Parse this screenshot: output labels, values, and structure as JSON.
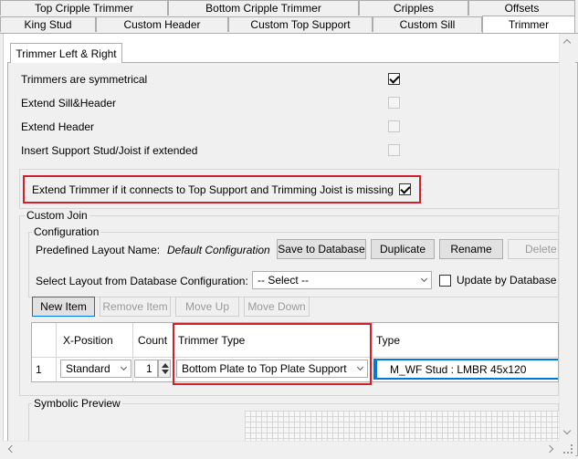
{
  "tabs_row1": [
    "Top Cripple Trimmer",
    "Bottom Cripple Trimmer",
    "Cripples",
    "Offsets"
  ],
  "tabs_row2": [
    "King Stud",
    "Custom Header",
    "Custom Top Support",
    "Custom Sill",
    "Trimmer"
  ],
  "inner_tab": "Trimmer Left & Right",
  "options": {
    "symmetrical": "Trimmers are symmetrical",
    "extend_sill_header": "Extend Sill&Header",
    "extend_header": "Extend Header",
    "insert_support": "Insert Support Stud/Joist if extended",
    "extend_trimmer": "Extend Trimmer if it connects to Top Support and Trimming Joist is missing"
  },
  "custom_join": {
    "title": "Custom Join",
    "configuration_title": "Configuration",
    "predefined_label": "Predefined Layout Name:",
    "predefined_value": "Default Configuration",
    "save_button": "Save to Database",
    "duplicate_button": "Duplicate",
    "rename_button": "Rename",
    "delete_button": "Delete",
    "select_layout_label": "Select Layout from Database Configuration:",
    "select_layout_value": "-- Select --",
    "update_by_db": "Update by Database"
  },
  "toolbar": {
    "new_item": "New Item",
    "remove_item": "Remove Item",
    "move_up": "Move Up",
    "move_down": "Move Down"
  },
  "grid": {
    "headers": [
      "X-Position",
      "Count",
      "Trimmer Type",
      "Type"
    ],
    "row": {
      "index": "1",
      "x_position": "Standard",
      "count": "1",
      "trimmer_type": "Bottom Plate to Top Plate Support",
      "type": "M_WF Stud : LMBR 45x120"
    }
  },
  "symbolic_preview": "Symbolic Preview",
  "colors": {
    "highlight": "#d0202a",
    "selection": "#0078d7"
  }
}
